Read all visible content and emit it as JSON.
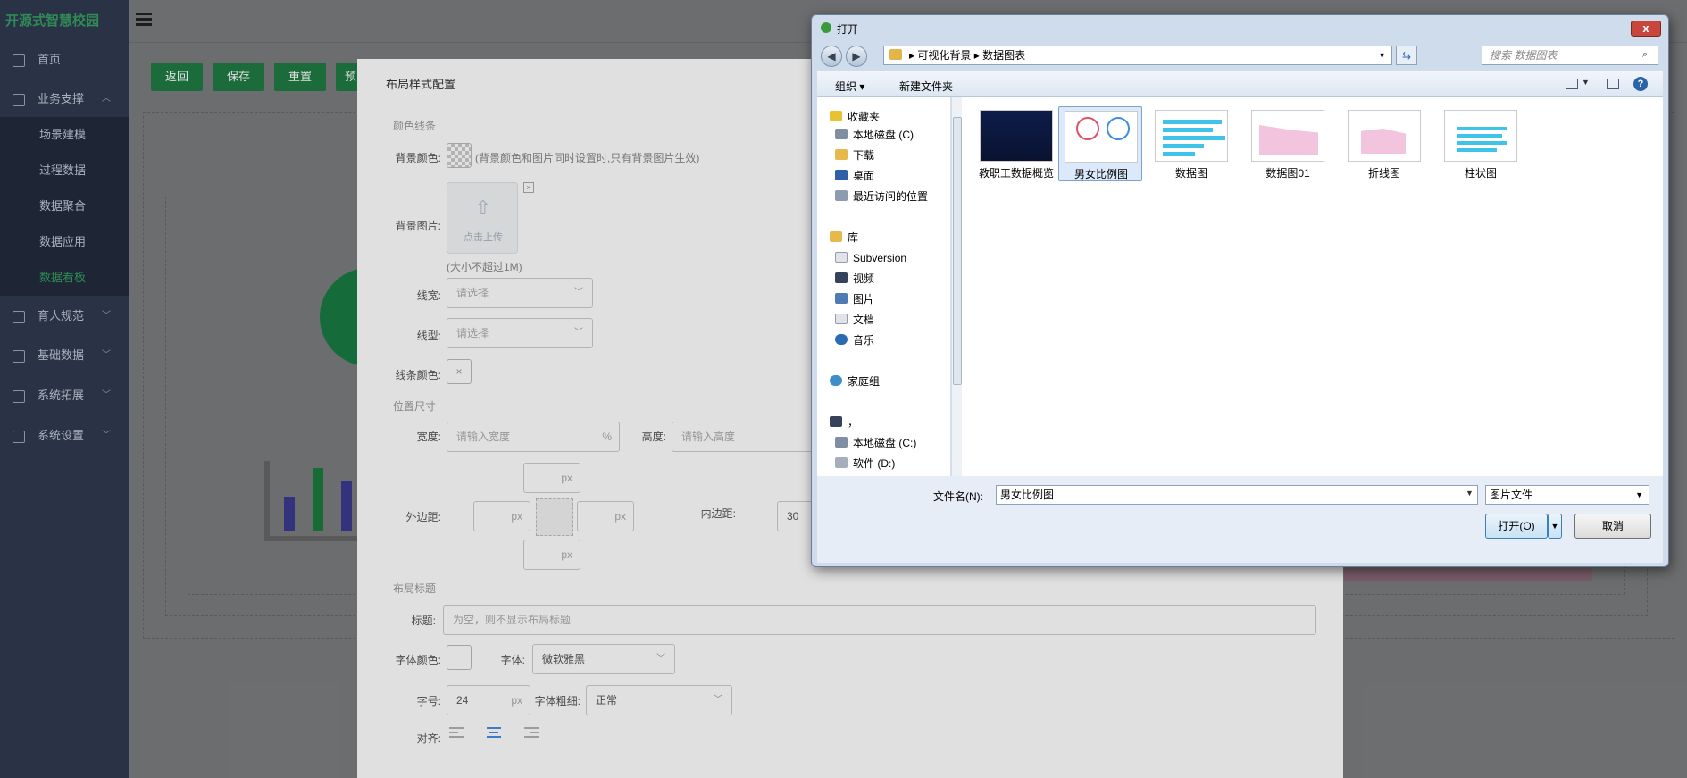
{
  "sidebar": {
    "logo_text": "开源式智慧校园",
    "items": [
      {
        "label": "首页"
      },
      {
        "label": "业务支撑"
      },
      {
        "label": "育人规范"
      },
      {
        "label": "基础数据"
      },
      {
        "label": "系统拓展"
      },
      {
        "label": "系统设置"
      }
    ],
    "sub_items": [
      {
        "label": "场景建模"
      },
      {
        "label": "过程数据"
      },
      {
        "label": "数据聚合"
      },
      {
        "label": "数据应用"
      },
      {
        "label": "数据看板"
      }
    ]
  },
  "toolbar": {
    "back_label": "返回",
    "save_label": "保存",
    "reset_label": "重置",
    "partial_label": "预"
  },
  "config": {
    "title": "布局样式配置",
    "section_color": "颜色线条",
    "bg_color_label": "背景颜色:",
    "bg_color_hint": "(背景颜色和图片同时设置时,只有背景图片生效)",
    "bg_image_label": "背景图片:",
    "upload_text": "点击上传",
    "upload_size_hint": "(大小不超过1M)",
    "line_width_label": "线宽:",
    "line_width_placeholder": "请选择",
    "line_type_label": "线型:",
    "line_type_placeholder": "请选择",
    "line_color_label": "线条颜色:",
    "section_size": "位置尺寸",
    "width_label": "宽度:",
    "width_placeholder": "请输入宽度",
    "width_unit": "%",
    "height_label": "高度:",
    "height_placeholder": "请输入高度",
    "margin_label": "外边距:",
    "padding_label": "内边距:",
    "padding_value": "30",
    "px_unit": "px",
    "section_title": "布局标题",
    "title_label": "标题:",
    "title_placeholder": "为空，则不显示布局标题",
    "font_color_label": "字体颜色:",
    "font_label": "字体:",
    "font_value": "微软雅黑",
    "font_size_label": "字号:",
    "font_size_value": "24",
    "font_weight_label": "字体粗细:",
    "font_weight_value": "正常",
    "align_label": "对齐:"
  },
  "file_dialog": {
    "title": "打开",
    "close_symbol": "x",
    "breadcrumb": [
      "可视化背景",
      "数据图表"
    ],
    "search_placeholder": "搜索 数据图表",
    "organize_label": "组织 ▾",
    "new_folder_label": "新建文件夹",
    "tree": [
      {
        "label": "收藏夹",
        "icon": "star-icon"
      },
      {
        "label": "本地磁盘 (C)",
        "icon": "drive-icon"
      },
      {
        "label": "下载",
        "icon": "download-folder-icon"
      },
      {
        "label": "桌面",
        "icon": "desktop-icon"
      },
      {
        "label": "最近访问的位置",
        "icon": "recent-icon"
      },
      {
        "label": "库",
        "icon": "library-icon"
      },
      {
        "label": "Subversion",
        "icon": "document-icon"
      },
      {
        "label": "视频",
        "icon": "video-icon"
      },
      {
        "label": "图片",
        "icon": "picture-icon"
      },
      {
        "label": "文档",
        "icon": "document-icon"
      },
      {
        "label": "音乐",
        "icon": "music-icon"
      },
      {
        "label": "家庭组",
        "icon": "homegroup-icon"
      },
      {
        "label": "，",
        "icon": "computer-icon"
      },
      {
        "label": "本地磁盘 (C:)",
        "icon": "drive-icon"
      },
      {
        "label": "软件 (D:)",
        "icon": "drive-icon"
      }
    ],
    "files": [
      {
        "name": "教职工数据概览",
        "thumb": "dark"
      },
      {
        "name": "男女比例图",
        "thumb": "gender",
        "selected": true
      },
      {
        "name": "数据图",
        "thumb": "bars"
      },
      {
        "name": "数据图01",
        "thumb": "pink"
      },
      {
        "name": "折线图",
        "thumb": "pink"
      },
      {
        "name": "柱状图",
        "thumb": "bars"
      }
    ],
    "filename_label": "文件名(N):",
    "filename_value": "男女比例图",
    "filetype_value": "图片文件",
    "open_label": "打开(O)",
    "cancel_label": "取消"
  },
  "colors": {
    "sidebar_bg": "#2a3346",
    "brand_green": "#1f7a44",
    "dialog_frame": "#cfdceb",
    "selection": "#dbe9fb"
  }
}
